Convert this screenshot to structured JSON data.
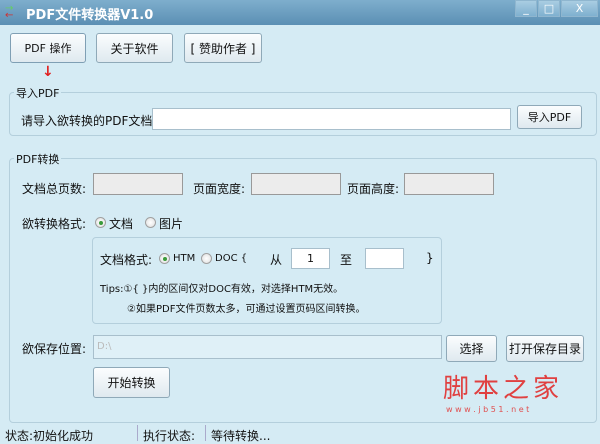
{
  "window": {
    "title": "PDF文件转换器V1.0",
    "minimize": "_",
    "maximize": "□",
    "close": "X"
  },
  "toolbar": {
    "pdf_ops": "PDF 操作",
    "about": "关于软件",
    "donate": "[ 赞助作者 ]"
  },
  "import_group": {
    "label": "导入PDF",
    "prompt": "请导入欲转换的PDF文档:",
    "path_value": "",
    "import_button": "导入PDF"
  },
  "convert_group": {
    "label": "PDF转换",
    "total_pages_label": "文档总页数:",
    "total_pages": "",
    "page_width_label": "页面宽度:",
    "page_width": "",
    "page_height_label": "页面高度:",
    "page_height": "",
    "format_label": "欲转换格式:",
    "format_options": [
      "文档",
      "图片"
    ],
    "format_selected": "文档",
    "doc_format_label": "文档格式:",
    "doc_options": [
      "HTM",
      "DOC {"
    ],
    "doc_selected": "HTM",
    "from_label": "从",
    "from_value": "1",
    "to_label": "至",
    "to_value": "",
    "close_brace": "}",
    "tips_line1": "Tips:①{ }内的区间仅对DOC有效，对选择HTM无效。",
    "tips_line2": "②如果PDF文件页数太多，可通过设置页码区间转换。",
    "save_label": "欲保存位置:",
    "save_path": "D:\\",
    "choose_button": "选择",
    "open_dir_button": "打开保存目录",
    "start_button": "开始转换"
  },
  "watermark": {
    "name": "脚本之家",
    "url": "w w w . j b 5 1 . n e t"
  },
  "status": {
    "state": "状态:初始化成功",
    "exec_label": "执行状态:",
    "exec_value": "等待转换..."
  }
}
